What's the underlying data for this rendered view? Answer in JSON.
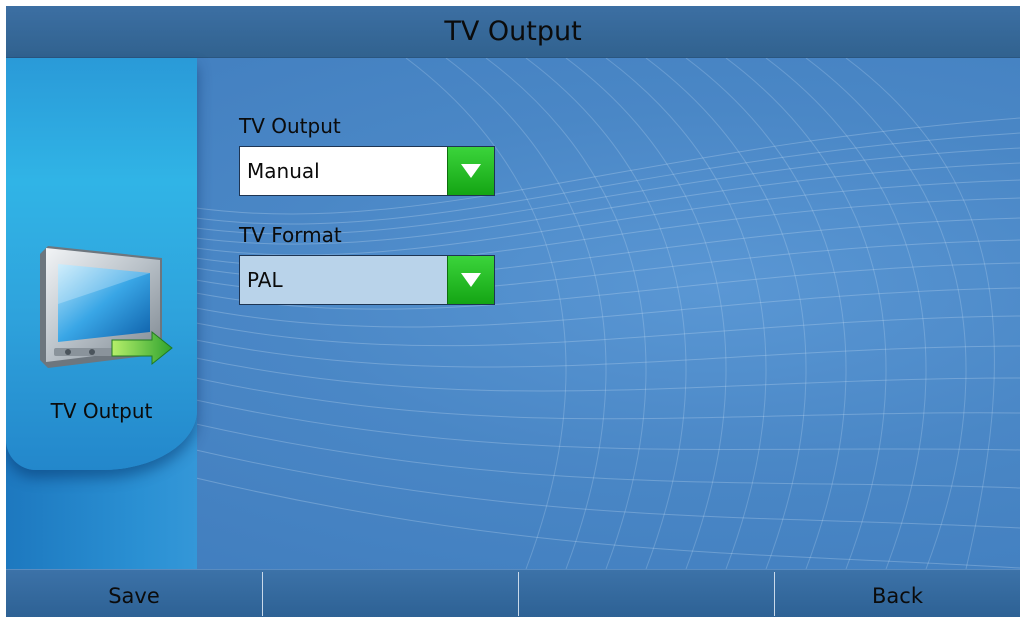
{
  "header": {
    "title": "TV Output"
  },
  "side_panel": {
    "icon": "tv-output-icon",
    "label": "TV Output"
  },
  "form": {
    "tv_output": {
      "label": "TV Output",
      "value": "Manual"
    },
    "tv_format": {
      "label": "TV Format",
      "value": "PAL"
    }
  },
  "softkeys": {
    "key1": "Save",
    "key2": "",
    "key3": "",
    "key4": "Back"
  },
  "colors": {
    "background": "#4a86c4",
    "header": "#3c6fa3",
    "dropdown_arrow": "#1fb51f",
    "focused_field": "#b9d3ea"
  }
}
